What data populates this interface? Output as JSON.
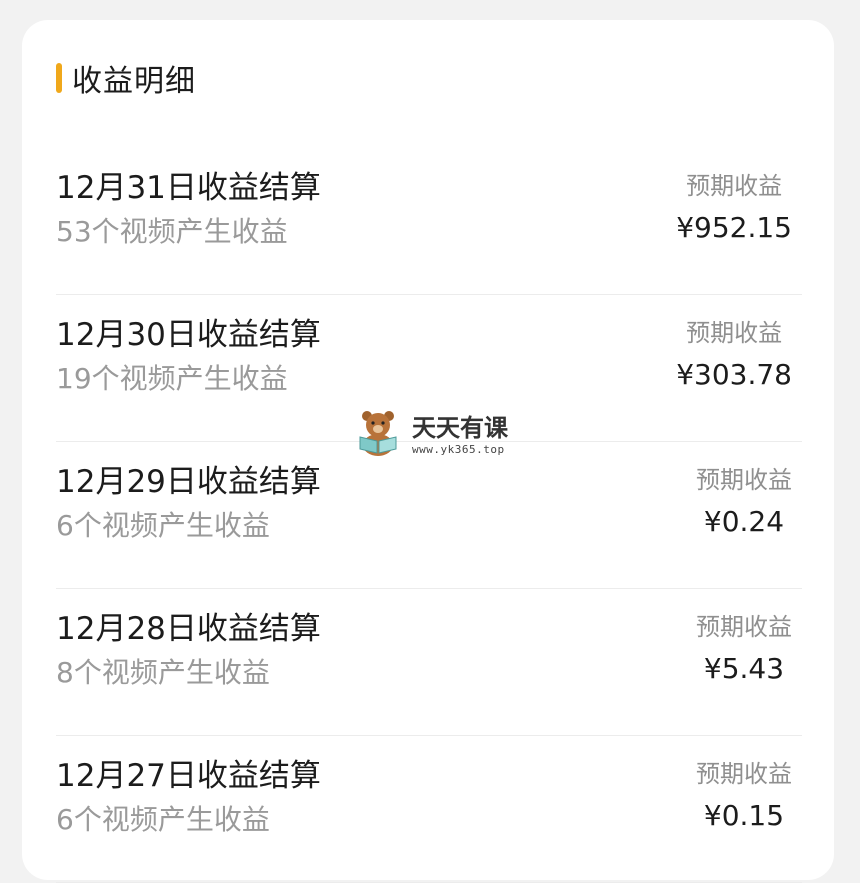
{
  "section": {
    "title": "收益明细"
  },
  "rows": [
    {
      "title": "12月31日收益结算",
      "subtitle": "53个视频产生收益",
      "label": "预期收益",
      "amount": "¥952.15"
    },
    {
      "title": "12月30日收益结算",
      "subtitle": "19个视频产生收益",
      "label": "预期收益",
      "amount": "¥303.78"
    },
    {
      "title": "12月29日收益结算",
      "subtitle": "6个视频产生收益",
      "label": "预期收益",
      "amount": "¥0.24"
    },
    {
      "title": "12月28日收益结算",
      "subtitle": "8个视频产生收益",
      "label": "预期收益",
      "amount": "¥5.43"
    },
    {
      "title": "12月27日收益结算",
      "subtitle": "6个视频产生收益",
      "label": "预期收益",
      "amount": "¥0.15"
    }
  ],
  "watermark": {
    "title": "天天有课",
    "url": "www.yk365.top",
    "icon": "bear-reading-logo"
  },
  "colors": {
    "accent": "#f0a81b",
    "background": "#f2f2f2",
    "card": "#ffffff",
    "primary_text": "#1c1c1c",
    "secondary_text": "#9a9a9a",
    "divider": "#ececec"
  }
}
